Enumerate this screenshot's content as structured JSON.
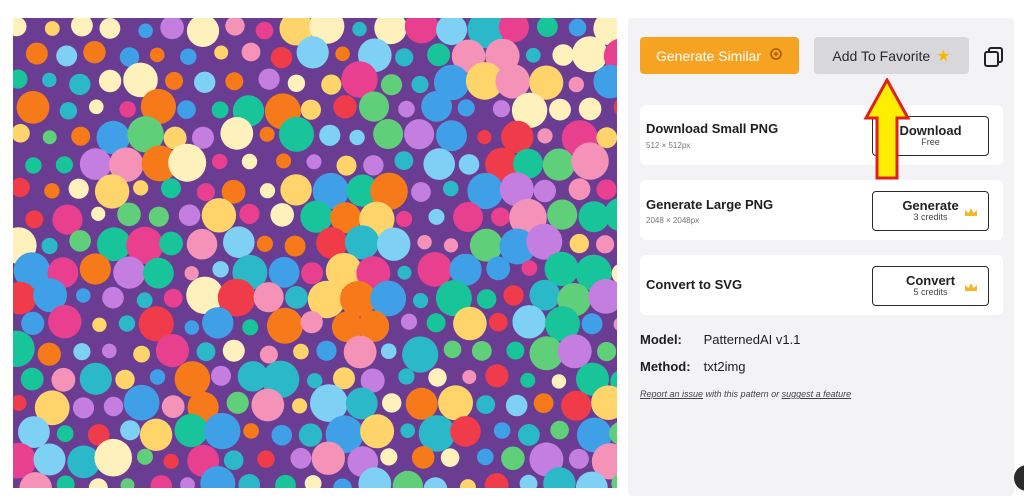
{
  "toolbar": {
    "generate_similar_label": "Generate Similar",
    "add_favorite_label": "Add To Favorite",
    "add_favorite_icon": "star-icon",
    "generate_similar_icon": "sparkle-icon",
    "copy_icon": "copy-icon"
  },
  "actions": [
    {
      "title": "Download Small PNG",
      "subtitle": "512 × 512px",
      "button": "Download",
      "button_sub": "Free",
      "premium": false
    },
    {
      "title": "Generate Large PNG",
      "subtitle": "2048 × 2048px",
      "button": "Generate",
      "button_sub": "3 credits",
      "premium": true
    },
    {
      "title": "Convert to SVG",
      "subtitle": "",
      "button": "Convert",
      "button_sub": "5 credits",
      "premium": true
    }
  ],
  "meta": {
    "model_label": "Model:",
    "model_value": "PatternedAI v1.1",
    "method_label": "Method:",
    "method_value": "txt2img"
  },
  "footer": {
    "report_link": "Report an issue",
    "middle_text": " with this pattern or ",
    "suggest_link": "suggest a feature"
  },
  "colors": {
    "background_purple": "#6a3c92",
    "accent_orange": "#f5a320",
    "arrow_yellow": "#ffee00",
    "arrow_outline": "#e0201c",
    "dot_palette": [
      "#f77a1a",
      "#3fa0e8",
      "#e8408f",
      "#5fcf7a",
      "#ffd46a",
      "#fff1bb",
      "#c47ee0",
      "#2bb8c9",
      "#ef3b4a",
      "#f592b8",
      "#7ed0f5",
      "#18c49a"
    ]
  }
}
